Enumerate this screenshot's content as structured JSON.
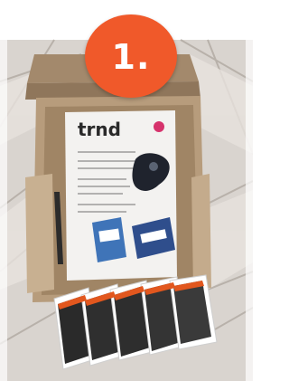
{
  "badge": {
    "number": "1.",
    "color": "#f0592a"
  },
  "letter": {
    "brand": "trnd"
  },
  "image": {
    "description_icon": "photo-unboxed-product-kit"
  }
}
